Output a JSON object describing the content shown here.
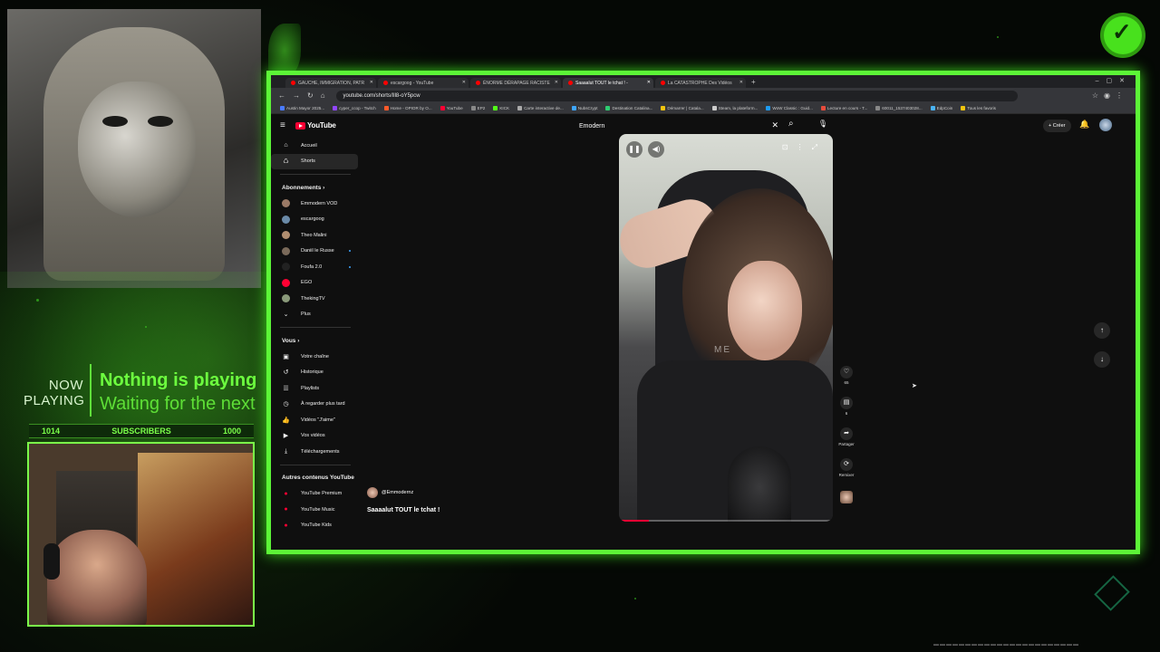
{
  "overlay": {
    "now_playing_label": "NOW PLAYING",
    "now_playing_title": "Nothing is playing",
    "now_playing_sub": "Waiting for the next",
    "subs_left": "1014",
    "subs_label": "SUBSCRIBERS",
    "subs_right": "1000",
    "accent_color": "#5cf537"
  },
  "browser": {
    "tabs": [
      {
        "label": "GAUCHE, IMMIGRATION, PATR",
        "active": false
      },
      {
        "label": "escargoog - YouTube",
        "active": false
      },
      {
        "label": "ÉNORME DÉRAPAGE RACISTE",
        "active": false
      },
      {
        "label": "Saaaalut TOUT le tchat ! -",
        "active": true
      },
      {
        "label": "La CATASTROPHE Des Vidéos",
        "active": false
      }
    ],
    "url": "youtube.com/shorts/Ill8-oY5pcw",
    "bookmarks": [
      "Austin Mayor 2025...",
      "cyper_ccop - Twitch",
      "Home - OPIOR by O...",
      "YouTube",
      "EP2",
      "KICK",
      "Carte interactive de...",
      "NubsCrypt",
      "Destination Catalina...",
      "Démarrer | Catala...",
      "Steam, la plateform...",
      "WoW Classic : Guid...",
      "Lecture en cours - T...",
      "60011_1537403028...",
      "EdpCoin",
      "Tous les favoris"
    ]
  },
  "youtube": {
    "logo_text": "YouTube",
    "search_value": "Emodern",
    "create_label": "Créer",
    "nav": [
      {
        "icon": "home-icon",
        "glyph": "⌂",
        "label": "Accueil"
      },
      {
        "icon": "shorts-icon",
        "glyph": "♺",
        "label": "Shorts"
      }
    ],
    "subs_heading": "Abonnements",
    "subscriptions": [
      {
        "label": "Emmodern VOD",
        "color": "#9a7a66",
        "dot": false
      },
      {
        "label": "escargoog",
        "color": "#6a8aa8",
        "dot": false
      },
      {
        "label": "Theo Malini",
        "color": "#b08e70",
        "dot": false
      },
      {
        "label": "Daniil le Russe",
        "color": "#7a6a5a",
        "dot": true
      },
      {
        "label": "Foufa 2.0",
        "color": "#222",
        "dot": true
      },
      {
        "label": "EGO",
        "color": "#ff0033",
        "dot": false
      },
      {
        "label": "ThekingTV",
        "color": "#8a9a7a",
        "dot": false
      }
    ],
    "more_label": "Plus",
    "you_heading": "Vous",
    "you_items": [
      {
        "glyph": "▣",
        "label": "Votre chaîne"
      },
      {
        "glyph": "↺",
        "label": "Historique"
      },
      {
        "glyph": "☰",
        "label": "Playlists"
      },
      {
        "glyph": "◷",
        "label": "À regarder plus tard"
      },
      {
        "glyph": "👍",
        "label": "Vidéos \"J'aime\""
      },
      {
        "glyph": "▶",
        "label": "Vos vidéos"
      },
      {
        "glyph": "⤓",
        "label": "Téléchargements"
      }
    ],
    "other_heading": "Autres contenus YouTube",
    "other_items": [
      {
        "label": "YouTube Premium",
        "color": "#ff0033"
      },
      {
        "label": "YouTube Music",
        "color": "#ff0033"
      },
      {
        "label": "YouTube Kids",
        "color": "#ff0033"
      }
    ],
    "short": {
      "channel": "@Emmodernz",
      "caption": "Saaaalut TOUT le tchat !",
      "overlay_text": "ME",
      "progress": 0.14,
      "likes": "65",
      "comments": "6",
      "share_label": "Partager",
      "remix_label": "Remixer"
    }
  }
}
